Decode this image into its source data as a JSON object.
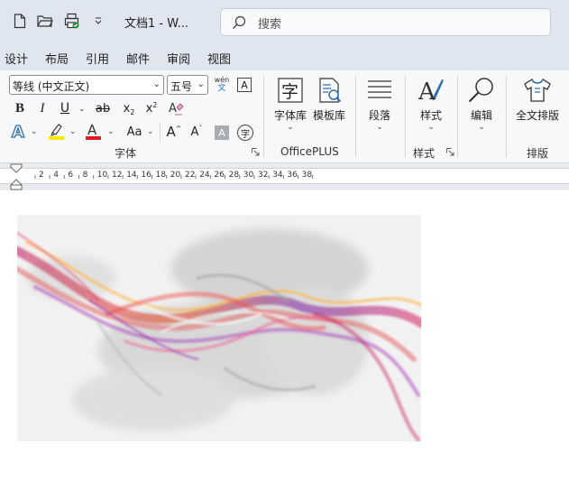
{
  "titlebar": {
    "doc_title": "文档1  -  W...",
    "search_placeholder": "搜索"
  },
  "tabs": [
    "设计",
    "布局",
    "引用",
    "邮件",
    "审阅",
    "视图"
  ],
  "font_group": {
    "font_name": "等线 (中文正文)",
    "font_size": "五号",
    "phonetic_top": "wén",
    "phonetic_bottom": "文",
    "border_char": "A",
    "bold": "B",
    "italic": "I",
    "underline": "U",
    "strike": "ab",
    "subscript": "x",
    "subscript_mark": "2",
    "superscript": "x",
    "superscript_mark": "2",
    "change_case": "Aa",
    "grow": "A",
    "shrink": "A",
    "shade_char": "A",
    "enclose_char": "字",
    "label": "字体"
  },
  "officeplus_group": {
    "buttons": [
      {
        "label": "字体库",
        "glyph": "字"
      },
      {
        "label": "模板库"
      }
    ],
    "label": "OfficePLUS"
  },
  "paragraph": {
    "label": "段落"
  },
  "styles_group": {
    "button": "样式",
    "label": "样式"
  },
  "edit": {
    "label": "编辑"
  },
  "layout_group": {
    "button": "全文排版",
    "label": "排版"
  },
  "ruler": {
    "marks": [
      "2",
      "4",
      "6",
      "8",
      "10",
      "12",
      "14",
      "16",
      "18",
      "20",
      "22",
      "24",
      "26",
      "28",
      "30",
      "32",
      "34",
      "36",
      "38"
    ]
  },
  "colors": {
    "highlight": "#ffe600",
    "font_color": "#e0191f",
    "accent": "#2b6cb0"
  }
}
